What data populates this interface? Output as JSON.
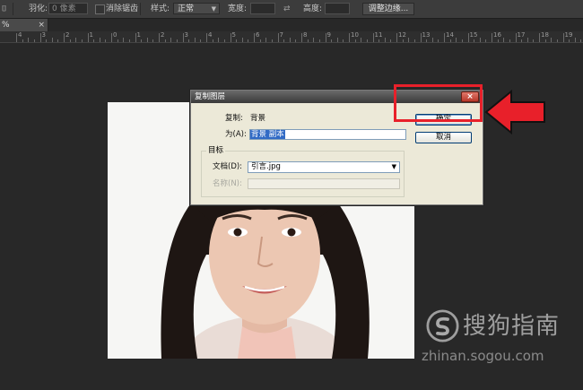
{
  "options_bar": {
    "feather_label": "羽化:",
    "feather_value": "0 像素",
    "antialias_label": "消除锯齿",
    "style_label": "样式:",
    "style_value": "正常",
    "width_label": "宽度:",
    "height_label": "高度:",
    "refine_edge_button": "调整边缘..."
  },
  "document_tab": {
    "title": "%(RGB/8#)",
    "close": "×"
  },
  "ruler": {
    "numbers": [
      "4",
      "3",
      "2",
      "1",
      "0",
      "1",
      "2",
      "3",
      "4",
      "5",
      "6",
      "7",
      "8",
      "9",
      "10",
      "11",
      "12",
      "13",
      "14",
      "15",
      "16",
      "17",
      "18",
      "19"
    ]
  },
  "dialog": {
    "title": "复制图层",
    "close": "×",
    "duplicate_label": "复制:",
    "duplicate_value": "背景",
    "as_label": "为(A):",
    "as_value": "背景 副本",
    "target_group": "目标",
    "document_label": "文档(D):",
    "document_value": "引言.jpg",
    "name_label": "名称(N):",
    "ok_button": "确定",
    "cancel_button": "取消"
  },
  "watermark": {
    "brand": "搜狗指南",
    "url": "zhinan.sogou.com"
  },
  "colors": {
    "highlight": "#e8202a",
    "arrow": "#e8202a",
    "selection": "#316ac5"
  }
}
